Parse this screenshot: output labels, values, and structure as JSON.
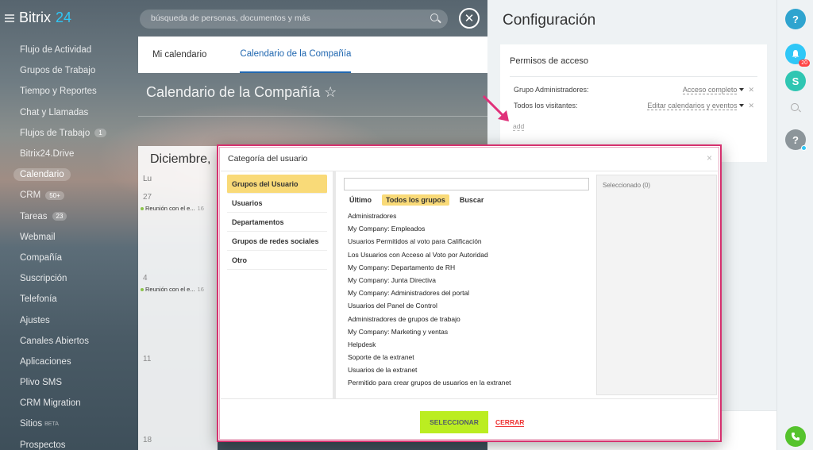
{
  "app": {
    "logo_main": "Bitrix",
    "logo_num": "24"
  },
  "sidebar": {
    "items": [
      {
        "label": "Flujo de Actividad"
      },
      {
        "label": "Grupos de Trabajo"
      },
      {
        "label": "Tiempo y Reportes"
      },
      {
        "label": "Chat y Llamadas"
      },
      {
        "label": "Flujos de Trabajo",
        "count": "1"
      },
      {
        "label": "Bitrix24.Drive"
      },
      {
        "label": "Calendario",
        "active": true
      },
      {
        "label": "CRM",
        "count": "50+"
      },
      {
        "label": "Tareas",
        "count": "23"
      },
      {
        "label": "Webmail"
      },
      {
        "label": "Compañía"
      },
      {
        "label": "Suscripción"
      },
      {
        "label": "Telefonía"
      },
      {
        "label": "Ajustes"
      },
      {
        "label": "Canales Abiertos"
      },
      {
        "label": "Aplicaciones"
      },
      {
        "label": "Plivo SMS"
      },
      {
        "label": "CRM Migration"
      },
      {
        "label": "Sitios",
        "beta": "BETA"
      },
      {
        "label": "Prospectos"
      }
    ]
  },
  "search": {
    "placeholder": "búsqueda de personas, documentos y más"
  },
  "calendar": {
    "tabs": [
      "Mi calendario",
      "Calendario de la Compañía"
    ],
    "title": "Calendario de la Compañía ☆",
    "month": "Diciembre,",
    "day_header": "Lu",
    "days": [
      "27",
      "4",
      "11",
      "18"
    ],
    "event_label": "Reunión con el e...",
    "event_time": "16"
  },
  "config": {
    "title": "Configuración",
    "access_header": "Permisos de acceso",
    "rows": [
      {
        "label": "Grupo Administradores:",
        "value": "Acceso completo"
      },
      {
        "label": "Todos los visitantes:",
        "value": "Editar calendarios y eventos"
      }
    ],
    "add_label": "add"
  },
  "rail": {
    "help": "?",
    "notif_count": "20",
    "avatar_text": "?"
  },
  "dialog": {
    "title": "Categoría del usuario",
    "close": "×",
    "categories": [
      "Grupos del Usuario",
      "Usuarios",
      "Departamentos",
      "Grupos de redes sociales",
      "Otro"
    ],
    "subtabs": [
      "Último",
      "Todos los grupos",
      "Buscar"
    ],
    "groups": [
      "Administradores",
      "My Company: Empleados",
      "Usuarios Permitidos al voto para Calificación",
      "Los Usuarios con Acceso al Voto por Autoridad",
      "My Company: Departamento de RH",
      "My Company: Junta Directiva",
      "My Company: Administradores del portal",
      "Usuarios del Panel de Control",
      "Administradores de grupos de trabajo",
      "My Company: Marketing y ventas",
      "Helpdesk",
      "Soporte de la extranet",
      "Usuarios de la extranet",
      "Permitido para crear grupos de usuarios en la extranet"
    ],
    "selected_label": "Seleccionado (0)",
    "select_button": "SELECCIONAR",
    "close_button": "CERRAR"
  }
}
